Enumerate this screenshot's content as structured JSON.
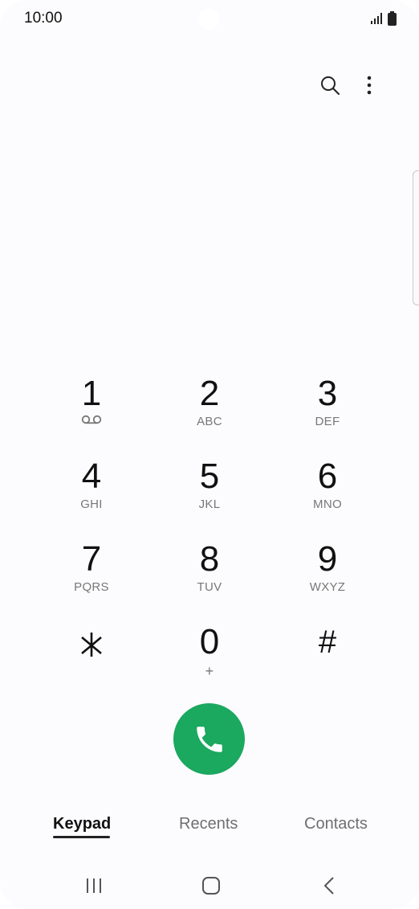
{
  "status_bar": {
    "time": "10:00"
  },
  "keypad": {
    "keys": [
      {
        "digit": "1",
        "sub": ""
      },
      {
        "digit": "2",
        "sub": "ABC"
      },
      {
        "digit": "3",
        "sub": "DEF"
      },
      {
        "digit": "4",
        "sub": "GHI"
      },
      {
        "digit": "5",
        "sub": "JKL"
      },
      {
        "digit": "6",
        "sub": "MNO"
      },
      {
        "digit": "7",
        "sub": "PQRS"
      },
      {
        "digit": "8",
        "sub": "TUV"
      },
      {
        "digit": "9",
        "sub": "WXYZ"
      },
      {
        "digit": "⁎",
        "sub": ""
      },
      {
        "digit": "0",
        "sub": "+"
      },
      {
        "digit": "#",
        "sub": ""
      }
    ]
  },
  "tabs": [
    {
      "label": "Keypad",
      "active": true
    },
    {
      "label": "Recents",
      "active": false
    },
    {
      "label": "Contacts",
      "active": false
    }
  ],
  "colors": {
    "call_green": "#1ba85f",
    "background": "#fcfcfe"
  },
  "icons": {
    "voicemail": "voicemail-icon",
    "search": "search-icon",
    "more": "more-vertical-icon",
    "call": "phone-icon"
  }
}
